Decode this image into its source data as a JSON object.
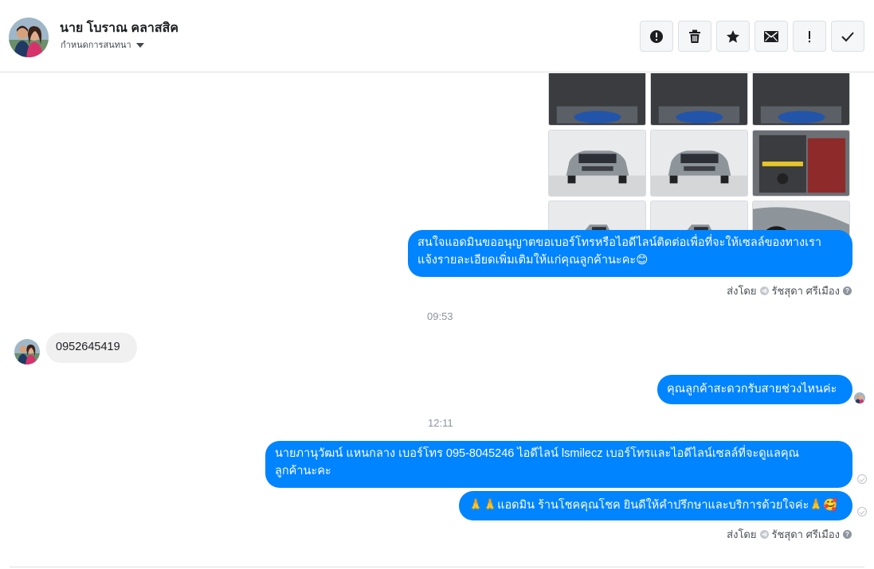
{
  "header": {
    "contact_name": "นาย โบราณ คลาสสิค",
    "conversation_status": "กำหนดการสนทนา",
    "toolbar": [
      {
        "name": "report-spam-button",
        "icon": "alert-circle-icon"
      },
      {
        "name": "delete-button",
        "icon": "trash-icon"
      },
      {
        "name": "star-button",
        "icon": "star-icon"
      },
      {
        "name": "mark-unread-button",
        "icon": "envelope-icon"
      },
      {
        "name": "important-button",
        "icon": "exclamation-icon"
      },
      {
        "name": "mark-done-button",
        "icon": "check-icon"
      }
    ]
  },
  "thread": {
    "photo_count": 9,
    "messages": {
      "m1_line1": "สนใจแอดมินขออนุญาตขอเบอร์โทรหรือไอดีไลน์ติดต่อเพื่อที่จะให้เซลล์ของทางเรา",
      "m1_line2": "แจ้งรายละเอียดเพิ่มเติมให้แก่คุณลูกค้านะคะ😊",
      "time1": "09:53",
      "incoming_phone": "0952645419",
      "m2": "คุณลูกค้าสะดวกรับสายช่วงไหนค่ะ",
      "time2": "12:11",
      "m3_line1": "นายภานุวัฒน์ แหนกลาง เบอร์โทร 095-8045246 ไอดีไลน์ lsmilecz  เบอร์โทรและไอดีไลน์เซลล์ที่จะดูแลคุณ",
      "m3_line2": "ลูกค้านะคะ",
      "m4": "🙏🙏แอดมิน ร้านโชคคุณโชค ยินดีให้คำปรึกษาและบริการด้วยใจค่ะ🙏🥰"
    },
    "sent_by_label": "ส่งโดย",
    "sender_name": "รัชสุดา ศรีเมือง"
  },
  "colors": {
    "bubble_out": "#0084ff",
    "bubble_in": "#f1f0f0",
    "car_body": "#8e959a"
  }
}
